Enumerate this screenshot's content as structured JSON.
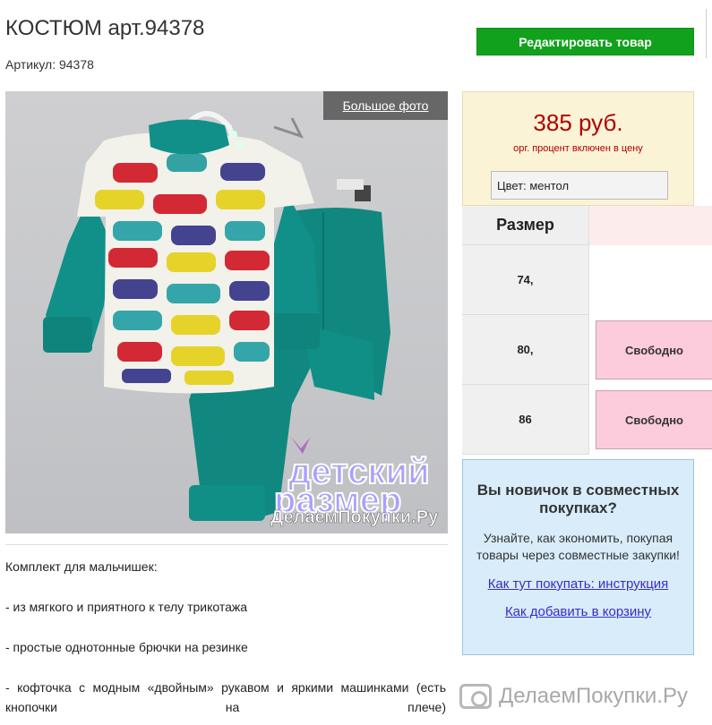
{
  "product": {
    "title": "КОСТЮМ арт.94378",
    "article": "Артикул: 94378",
    "big_photo_label": "Большое фото",
    "photo_watermark": {
      "line1": "детский",
      "line2": "размер",
      "line3": "ДелаемПокупки.Ру"
    }
  },
  "toolbar": {
    "edit_label": "Редактировать товар"
  },
  "price": {
    "value": "385 руб.",
    "note": "орг. процент включен в цену",
    "color_label": "Цвет:  ментол"
  },
  "sizes": {
    "header": "Размер",
    "rows": [
      {
        "size": "74,",
        "status": ""
      },
      {
        "size": "80,",
        "status": "Свободно"
      },
      {
        "size": "86",
        "status": "Свободно"
      }
    ]
  },
  "description": {
    "lines": [
      "Комплект для мальчишек:",
      "- из мягкого и приятного к телу трикотажа",
      "- простые однотонные брючки на резинке",
      "- кофточка с модным «двойным» рукавом и яркими машинками (есть кнопочки на плече)"
    ]
  },
  "newbie": {
    "heading": "Вы новичок в совместных покупках?",
    "text": "Узнайте, как экономить, покупая товары через совместные закупки!",
    "link1": "Как тут покупать: инструкция",
    "link2": "Как добавить в корзину"
  },
  "watermark": {
    "text": "ДелаемПокупки.Ру"
  },
  "colors": {
    "edit_button": "#12a11d",
    "price": "#b00000",
    "free_button": "#fcccdc",
    "price_box": "#fbf3d6",
    "newbie_box": "#d8ecfa",
    "teal": "#0f8f86"
  }
}
